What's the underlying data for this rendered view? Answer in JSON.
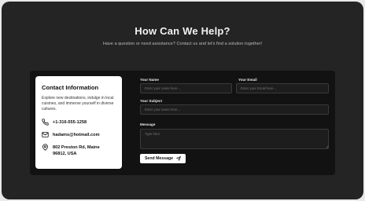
{
  "header": {
    "title": "How Can We Help?",
    "subtitle": "Have a question or need assistance? Contact us and let's find a solution together!"
  },
  "contact_card": {
    "title": "Contact Information",
    "description": "Explore new destinations, indulge in local cuisines, and immerse yourself in diverse cultures.",
    "items": [
      {
        "icon": "phone-icon",
        "text": "+1-316-555-1258"
      },
      {
        "icon": "mail-icon",
        "text": "hadams@hotmail.com"
      },
      {
        "icon": "location-pin-icon",
        "text": "802 Preston Rd, Maine 96812, USA"
      }
    ]
  },
  "form": {
    "name": {
      "label": "Your Name",
      "placeholder": "Enter your name here..."
    },
    "email": {
      "label": "Your Email",
      "placeholder": "Enter your Email here..."
    },
    "subject": {
      "label": "Your Subject",
      "placeholder": "Enter your name here..."
    },
    "message": {
      "label": "Message",
      "placeholder": "Type here"
    },
    "submit_label": "Send Message",
    "submit_icon": "send-icon"
  },
  "colors": {
    "page_background": "#242424",
    "form_panel": "#121212",
    "card_background": "#ffffff",
    "input_background": "#1d1d1d"
  }
}
